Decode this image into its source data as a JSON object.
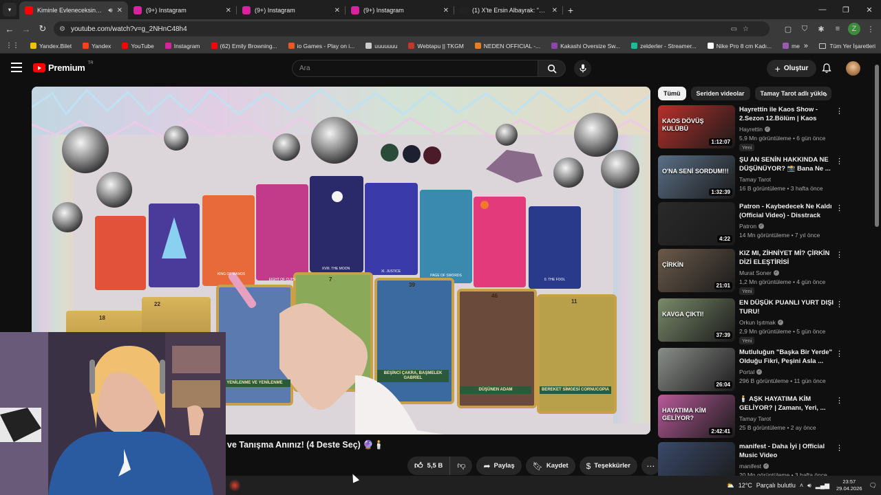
{
  "browser": {
    "tabs": [
      {
        "title": "Kiminle Evleneceksin? 🕯️ A",
        "fav_color": "#ff0000",
        "active": true
      },
      {
        "title": "(9+) Instagram",
        "fav_color": "#d6249f",
        "active": false
      },
      {
        "title": "(9+) Instagram",
        "fav_color": "#d6249f",
        "active": false
      },
      {
        "title": "(9+) Instagram",
        "fav_color": "#d6249f",
        "active": false
      },
      {
        "title": "(1) X'te Ersin Albayrak: \"edite b",
        "fav_color": "#222222",
        "active": false
      }
    ],
    "url": "youtube.com/watch?v=g_2NHnC48h4",
    "profile_letter": "Z",
    "bookmarks": [
      {
        "label": "Yandex.Bilet",
        "color": "#f2c200"
      },
      {
        "label": "Yandex",
        "color": "#fc3f1d"
      },
      {
        "label": "YouTube",
        "color": "#ff0000"
      },
      {
        "label": "Instagram",
        "color": "#d6249f"
      },
      {
        "label": "(62) Emily Browning...",
        "color": "#ff0000"
      },
      {
        "label": "io Games - Play on i...",
        "color": "#e85a1e"
      },
      {
        "label": "uuuuuuu",
        "color": "#cccccc"
      },
      {
        "label": "Webtapu || TKGM",
        "color": "#c0392b"
      },
      {
        "label": "NEDEN OFFICIAL -...",
        "color": "#e67e22"
      },
      {
        "label": "Kakashi Oversize Sw...",
        "color": "#8e44ad"
      },
      {
        "label": "zelderler - Streamer...",
        "color": "#1abc9c"
      },
      {
        "label": "Nike Pro 8 cm Kadı...",
        "color": "#ffffff"
      },
      {
        "label": "me",
        "color": "#9b59b6"
      }
    ],
    "all_bookmarks": "Tüm Yer İşaretleri",
    "more_bookmarks": "»"
  },
  "youtube": {
    "logo_text": "Premium",
    "logo_country": "TR",
    "search_placeholder": "Ara",
    "create_label": "Oluştur",
    "video_title": "ve Tanışma Anınız! (4 Deste Seç) 🔮🕯️",
    "like_count": "5,5 B",
    "share_label": "Paylaş",
    "save_label": "Kaydet",
    "thanks_label": "Teşekkürler",
    "chips": [
      "Tümü",
      "Seriden videolar",
      "Tamay Tarot adlı yükle"
    ],
    "recommendations": [
      {
        "title": "Hayrettin ile Kaos Show - 2.Sezon 12.Bölüm | Kaos Dövü...",
        "channel": "Hayrettin",
        "verified": true,
        "meta": "5,9 Mn görüntüleme • 6 gün önce",
        "badge": "Yeni",
        "duration": "1:12:07",
        "thumb_text": "KAOS DÖVÜŞ KULÜBÜ",
        "thumb_color": "#b8302a"
      },
      {
        "title": "ŞU AN SENİN HAKKINDA NE DÜŞÜNÜYOR? 📸 Bana Ne ...",
        "channel": "Tamay Tarot",
        "verified": false,
        "meta": "16 B görüntüleme • 3 hafta önce",
        "badge": "",
        "duration": "1:32:39",
        "thumb_text": "O'NA SENİ SORDUM!!!",
        "thumb_color": "#5a6f86"
      },
      {
        "title": "Patron - Kaybedecek Ne Kaldı (Official Video) - Disstrack",
        "channel": "Patron",
        "verified": true,
        "meta": "14 Mn görüntüleme • 7 yıl önce",
        "badge": "",
        "duration": "4:22",
        "thumb_text": "",
        "thumb_color": "#2a2a2a"
      },
      {
        "title": "KIZ MI, ZİHNİYET Mİ? ÇİRKİN DİZİ ELEŞTİRİSİ",
        "channel": "Murat Soner",
        "verified": true,
        "meta": "1,2 Mn görüntüleme • 4 gün önce",
        "badge": "Yeni",
        "duration": "21:01",
        "thumb_text": "ÇİRKİN",
        "thumb_color": "#6b5a4a"
      },
      {
        "title": "EN DÜŞÜK PUANLI YURT DIŞI TURU!",
        "channel": "Orkun Işıtmak",
        "verified": true,
        "meta": "2,9 Mn görüntüleme • 5 gün önce",
        "badge": "Yeni",
        "duration": "37:39",
        "thumb_text": "KAVGA ÇIKTI!",
        "thumb_color": "#7a8a6a"
      },
      {
        "title": "Mutluluğun \"Başka Bir Yerde\" Olduğu Fikri, Peşini Asla ...",
        "channel": "Portal",
        "verified": true,
        "meta": "296 B görüntüleme • 11 gün önce",
        "badge": "",
        "duration": "26:04",
        "thumb_text": "",
        "thumb_color": "#8a8e8a"
      },
      {
        "title": "🕯️ AŞK HAYATIMA KİM GELİYOR? | Zamanı, Yeri, ...",
        "channel": "Tamay Tarot",
        "verified": false,
        "meta": "25 B görüntüleme • 2 ay önce",
        "badge": "",
        "duration": "2:42:41",
        "thumb_text": "HAYATIMA KİM GELİYOR?",
        "thumb_color": "#b85a9a"
      },
      {
        "title": "manifest - Daha İyi | Official Music Video",
        "channel": "manifest",
        "verified": true,
        "meta": "20 Mn görüntüleme • 3 hafta önce",
        "badge": "",
        "duration": "",
        "thumb_text": "",
        "thumb_color": "#3a4a6a"
      }
    ]
  },
  "video_frame": {
    "card_labels_top": [
      "KING OF WANDS",
      "EIGHT OF CUPS",
      "XVIII. THE MOON",
      "XI. JUSTICE",
      "PAGE OF SWORDS",
      "0. THE FOOL"
    ],
    "card_numbers": [
      "18",
      "22",
      "7",
      "39",
      "46",
      "11"
    ],
    "card_labels_bottom": [
      "YENİLENME VE YENİLENME",
      "BEŞİNCİ ÇAKRA, BAŞMELEK GABRİEL",
      "DÜŞÜNEN ADAM",
      "BEREKET SİMGESİ CORNUCOPIA"
    ]
  },
  "taskbar": {
    "weather": "12°C",
    "weather_text": "Parçalı bulutlu",
    "time": "23:57",
    "date": "29.04.2026"
  }
}
